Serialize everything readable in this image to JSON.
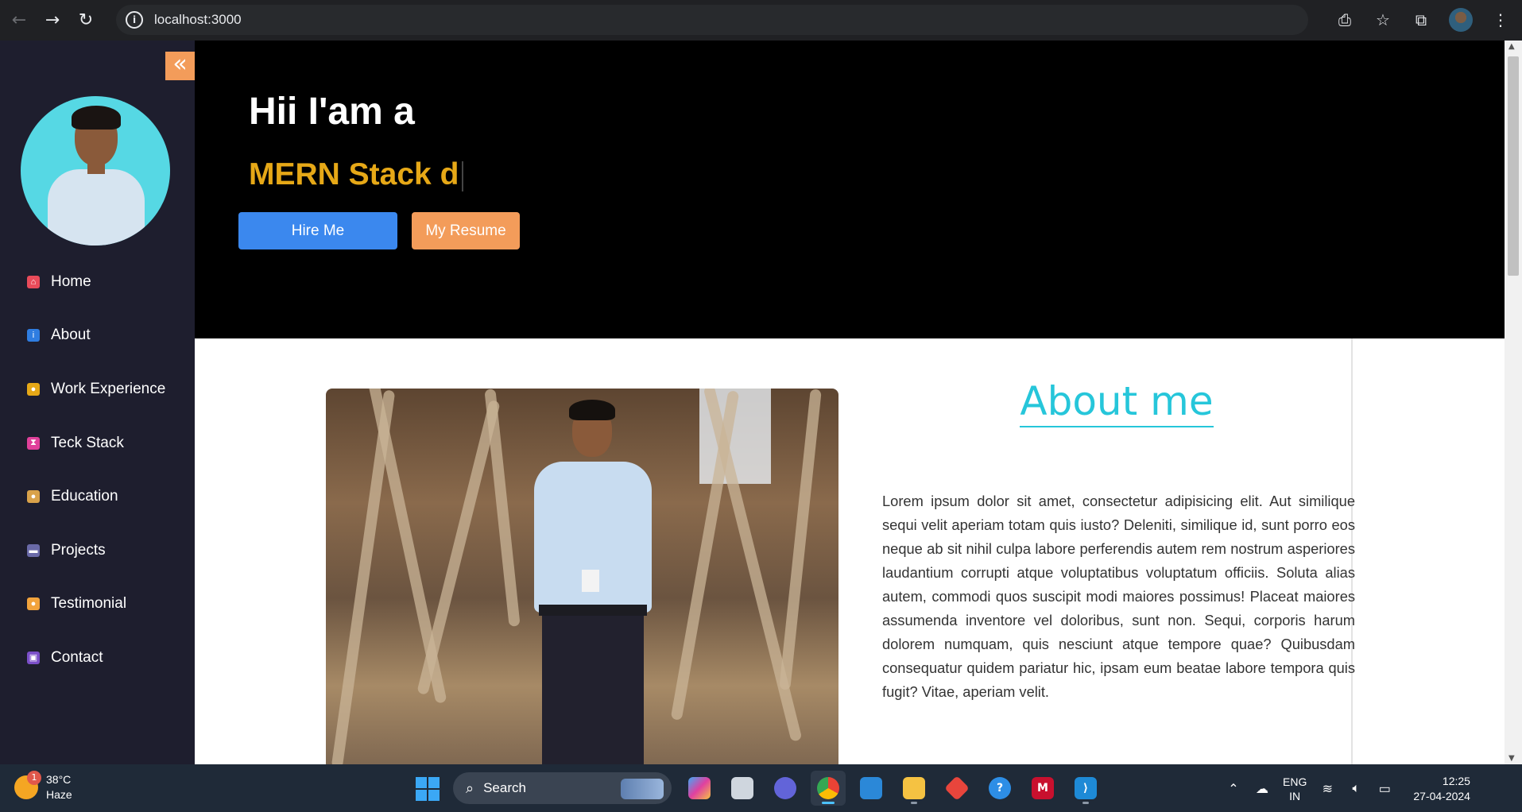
{
  "browser": {
    "url": "localhost:3000",
    "icons": [
      "back-arrow-icon",
      "forward-arrow-icon",
      "reload-icon",
      "site-info-icon",
      "install-app-icon",
      "bookmark-star-icon",
      "extensions-icon",
      "profile-avatar",
      "menu-kebab-icon"
    ]
  },
  "sidebar": {
    "collapse_label": "«",
    "items": [
      {
        "label": "Home",
        "icon": "home-icon",
        "color": "#e94b5a"
      },
      {
        "label": "About",
        "icon": "info-icon",
        "color": "#2f7de1"
      },
      {
        "label": "Work Experience",
        "icon": "worker-icon",
        "color": "#e6a817"
      },
      {
        "label": "Teck Stack",
        "icon": "hourglass-icon",
        "color": "#e0409a"
      },
      {
        "label": "Education",
        "icon": "student-icon",
        "color": "#d9a24a"
      },
      {
        "label": "Projects",
        "icon": "gamepad-icon",
        "color": "#6a6aa8"
      },
      {
        "label": "Testimonial",
        "icon": "people-icon",
        "color": "#f2a33c"
      },
      {
        "label": "Contact",
        "icon": "contact-card-icon",
        "color": "#7b4fc9"
      }
    ]
  },
  "hero": {
    "greeting": "Hii I'am a",
    "typed_text": "MERN Stack d",
    "hire_label": "Hire Me",
    "resume_label": "My Resume",
    "colors": {
      "hire": "#3b88ee",
      "resume": "#f39c5a",
      "typed": "#e6a817"
    }
  },
  "about": {
    "title": "About me",
    "body": "Lorem ipsum dolor sit amet, consectetur adipisicing elit. Aut similique sequi velit aperiam totam quis iusto? Deleniti, similique id, sunt porro eos neque ab sit nihil culpa labore perferendis autem rem nostrum asperiores laudantium corrupti atque voluptatibus voluptatum officiis. Soluta alias autem, commodi quos suscipit modi maiores possimus! Placeat maiores assumenda inventore vel doloribus, sunt non. Sequi, corporis harum dolorem numquam, quis nesciunt atque tempore quae? Quibusdam consequatur quidem pariatur hic, ipsam eum beatae labore tempora quis fugit? Vitae, aperiam velit."
  },
  "taskbar": {
    "weather_badge": "1",
    "temperature": "38°C",
    "condition": "Haze",
    "search_label": "Search",
    "apps": [
      "copilot-icon",
      "task-view-icon",
      "meet-icon",
      "chrome-icon",
      "store-icon",
      "file-explorer-icon",
      "git-icon",
      "help-icon",
      "mcafee-icon",
      "vscode-icon"
    ],
    "lang_top": "ENG",
    "lang_bottom": "IN",
    "time": "12:25",
    "date": "27-04-2024"
  }
}
